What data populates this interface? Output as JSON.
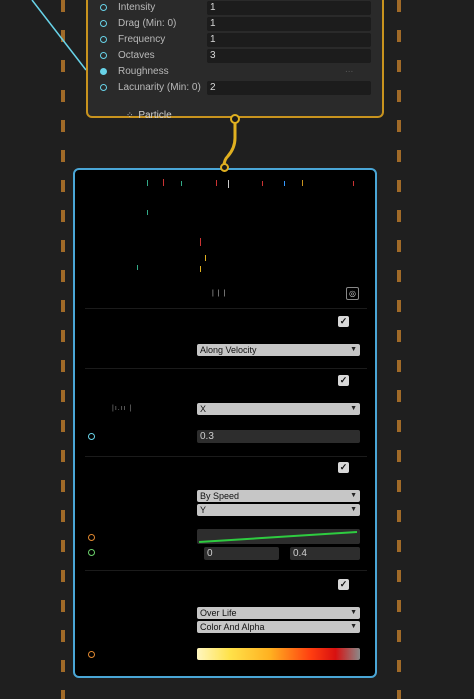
{
  "top_node": {
    "properties": [
      {
        "label": "Intensity",
        "value": "1",
        "port": "outline"
      },
      {
        "label": "Drag (Min: 0)",
        "value": "1",
        "port": "outline"
      },
      {
        "label": "Frequency",
        "value": "1",
        "port": "outline"
      },
      {
        "label": "Octaves",
        "value": "3",
        "port": "outline"
      },
      {
        "label": "Roughness",
        "value": "",
        "port": "filled"
      },
      {
        "label": "Lacunarity (Min: 0)",
        "value": "2",
        "port": "outline"
      }
    ],
    "roughness_hint": "...",
    "title": "Particle",
    "title_icon": "particle-icon"
  },
  "blocks": {
    "b1": {
      "checked": true,
      "dropdown": "Along Velocity"
    },
    "b2": {
      "checked": true,
      "dropdown": "X",
      "value": "0.3"
    },
    "b3": {
      "checked": true,
      "dropdown1": "By Speed",
      "dropdown2": "Y",
      "range_min": "0",
      "range_max": "0.4"
    },
    "b4": {
      "checked": true,
      "dropdown1": "Over Life",
      "dropdown2": "Color And Alpha"
    }
  },
  "colors": {
    "accent_orange": "#c8931e",
    "select_blue": "#4aa6d6",
    "port_cyan": "#68d3e8",
    "curve_green": "#2ecc40"
  }
}
